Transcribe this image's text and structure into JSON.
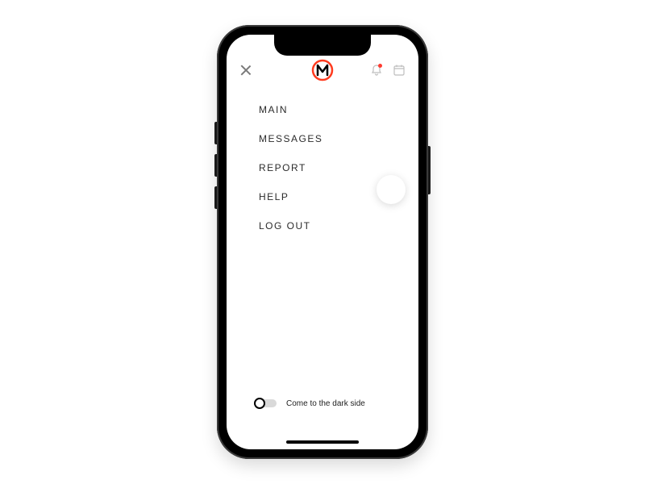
{
  "menu": {
    "items": [
      {
        "label": "MAIN"
      },
      {
        "label": "MESSAGES"
      },
      {
        "label": "REPORT"
      },
      {
        "label": "HELP"
      },
      {
        "label": "LOG OUT"
      }
    ]
  },
  "dark_mode": {
    "label": "Come to the dark side",
    "enabled": false
  },
  "colors": {
    "accent": "#ff3b1f",
    "notification_dot": "#ff3b30"
  }
}
